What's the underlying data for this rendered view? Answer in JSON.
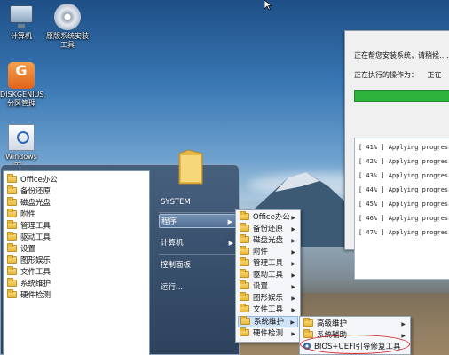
{
  "desktop": {
    "icons": [
      {
        "label": "计算机",
        "icon": "computer-icon"
      },
      {
        "label": "原版系统安装工具",
        "icon": "disc-icon"
      },
      {
        "label": "DISKGENIUS分区管理",
        "icon": "diskgenius-icon"
      },
      {
        "label": "Windows安…",
        "icon": "windows-installer-icon"
      }
    ]
  },
  "installer": {
    "line1": "正在帮您安装系统，请稍候……",
    "line2_label": "正在执行的操作为：",
    "line2_value": "正在",
    "progress_fraction": 0.95,
    "log": [
      "[  41% ] Applying progress:",
      "[  42% ] Applying progress:",
      "[  43% ] Applying progress:",
      "[  44% ] Applying progress:",
      "[  45% ] Applying progress:",
      "[  46% ] Applying progress:",
      "[  47% ] Applying progress:"
    ]
  },
  "start_menu": {
    "left_items": [
      "Office办公",
      "备份还原",
      "磁盘光盘",
      "附件",
      "管理工具",
      "驱动工具",
      "设置",
      "图形娱乐",
      "文件工具",
      "系统维护",
      "硬件检测"
    ],
    "right_items": [
      {
        "label": "SYSTEM",
        "arrow": false,
        "active": false
      },
      {
        "label": "程序",
        "arrow": true,
        "active": true
      },
      {
        "label": "计算机",
        "arrow": true,
        "active": false
      },
      {
        "label": "控制面板",
        "arrow": false,
        "active": false
      },
      {
        "label": "运行...",
        "arrow": false,
        "active": false
      }
    ]
  },
  "programs_menu": {
    "items": [
      {
        "label": "Office办公",
        "arrow": true
      },
      {
        "label": "备份还原",
        "arrow": true
      },
      {
        "label": "磁盘光盘",
        "arrow": true
      },
      {
        "label": "附件",
        "arrow": true
      },
      {
        "label": "管理工具",
        "arrow": true
      },
      {
        "label": "驱动工具",
        "arrow": true
      },
      {
        "label": "设置",
        "arrow": true
      },
      {
        "label": "图形娱乐",
        "arrow": true
      },
      {
        "label": "文件工具",
        "arrow": true
      },
      {
        "label": "系统维护",
        "arrow": true,
        "highlight": true
      },
      {
        "label": "硬件检测",
        "arrow": true
      }
    ]
  },
  "system_maintenance_menu": {
    "items": [
      {
        "label": "高级维护",
        "arrow": true
      },
      {
        "label": "系统辅助",
        "arrow": true
      },
      {
        "label": "BIOS+UEFI引导修复工具",
        "arrow": false,
        "circled": true
      }
    ]
  },
  "colors": {
    "progress_green": "#2bb33b",
    "highlight_ring": "#d8262a",
    "menu_highlight": "#cfe2f7"
  }
}
